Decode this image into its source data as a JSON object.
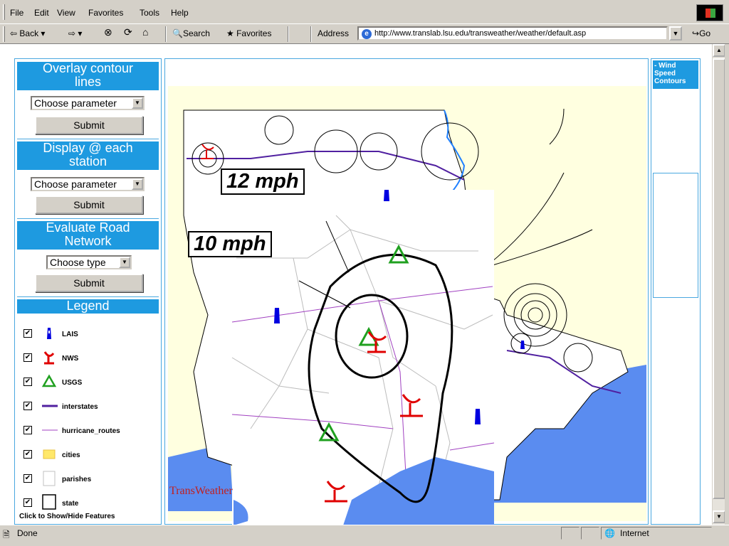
{
  "menus": [
    "File",
    "Edit",
    "View",
    "Favorites",
    "Tools",
    "Help"
  ],
  "toolbar": {
    "back_label": "Back",
    "search_label": "Search",
    "favorites_label": "Favorites",
    "address_label": "Address",
    "address_url": "http://www.translab.lsu.edu/transweather/weather/default.asp",
    "go_label": "Go"
  },
  "left_panel": {
    "overlay": {
      "heading_line1": "Overlay contour",
      "heading_line2": "lines",
      "select": "Choose parameter",
      "submit": "Submit"
    },
    "display": {
      "heading_line1": "Display @ each",
      "heading_line2": "station",
      "select": "Choose parameter",
      "submit": "Submit"
    },
    "evaluate": {
      "heading_line1": "Evaluate Road",
      "heading_line2": "Network",
      "select": "Choose type",
      "submit": "Submit"
    },
    "legend": {
      "heading": "Legend",
      "items": [
        {
          "label": "LAIS",
          "icon": "lais-station-icon",
          "checked": true
        },
        {
          "label": "NWS",
          "icon": "nws-radar-icon",
          "checked": true
        },
        {
          "label": "USGS",
          "icon": "usgs-triangle-icon",
          "checked": true
        },
        {
          "label": "interstates",
          "icon": "interstate-line-icon",
          "checked": true
        },
        {
          "label": "hurricane_routes",
          "icon": "hurricane-route-line-icon",
          "checked": true
        },
        {
          "label": "cities",
          "icon": "city-swatch-icon",
          "checked": true
        },
        {
          "label": "parishes",
          "icon": "parish-outline-icon",
          "checked": true
        },
        {
          "label": "state",
          "icon": "state-outline-icon",
          "checked": true
        }
      ],
      "footer": "Click to Show/Hide Features"
    }
  },
  "right_panel": {
    "heading_line1": "- Wind",
    "heading_line2": "Speed",
    "heading_line3": "Contours"
  },
  "map": {
    "label_12": "12 mph",
    "label_10": "10 mph",
    "watermark": "TransWeather"
  },
  "status": {
    "text": "Done",
    "zone": "Internet"
  },
  "colors": {
    "panel_header": "#1e9ae0",
    "map_background": "#ffffe0",
    "water": "#5a8cf0",
    "nws": "#e00000",
    "usgs": "#20a020",
    "lais": "#0000e0",
    "interstate": "#5020a0",
    "hurricane_route": "#a040c0"
  }
}
